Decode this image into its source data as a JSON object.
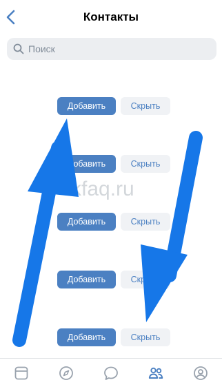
{
  "header": {
    "title": "Контакты",
    "back_icon": "chevron-left-icon"
  },
  "search": {
    "placeholder": "Поиск",
    "icon": "search-icon"
  },
  "contacts": [
    {
      "add_label": "Добавить",
      "hide_label": "Скрыть"
    },
    {
      "add_label": "Добавить",
      "hide_label": "Скрыть"
    },
    {
      "add_label": "Добавить",
      "hide_label": "Скрыть"
    },
    {
      "add_label": "Добавить",
      "hide_label": "Скрыть"
    },
    {
      "add_label": "Добавить",
      "hide_label": "Скрыть"
    }
  ],
  "watermark": "vkfaq.ru",
  "tabbar": {
    "items": [
      "news-icon",
      "compass-icon",
      "messages-icon",
      "friends-icon",
      "profile-icon"
    ],
    "active": "friends-icon"
  },
  "colors": {
    "accent": "#4b80c2",
    "arrow": "#1677e8",
    "secondary_button": "#f0f2f5"
  }
}
